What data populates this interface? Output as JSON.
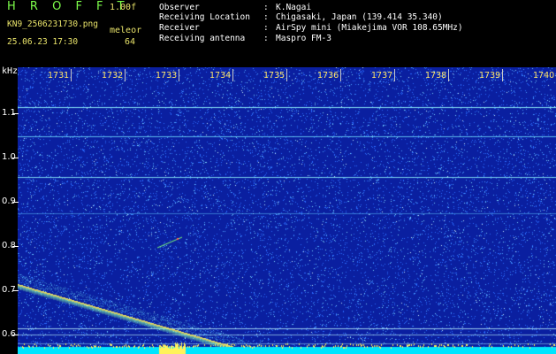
{
  "header": {
    "app_title": "H R O F F T",
    "version": "1.00f",
    "file": "KN9_2506231730.png",
    "mode": "meleor",
    "datetime": "25.06.23 17:30",
    "number": "64",
    "info": [
      {
        "label": "Observer",
        "value": "K.Nagai"
      },
      {
        "label": "Receiving Location",
        "value": "Chigasaki, Japan (139.414 35.340)"
      },
      {
        "label": "Receiver",
        "value": "AirSpy mini (Miakejima VOR 108.65MHz)"
      },
      {
        "label": "Receiving antenna",
        "value": "Maspro FM-3"
      }
    ]
  },
  "chart_data": {
    "type": "heatmap",
    "ylabel": "kHz",
    "y_ticks": [
      "1.1",
      "1.0",
      "0.9",
      "0.8",
      "0.7",
      "0.6"
    ],
    "x_ticks": [
      "1731",
      "1732",
      "1733",
      "1734",
      "1735",
      "1736",
      "1737",
      "1738",
      "1739",
      "1740"
    ],
    "colors": {
      "background": "#0a1fa0",
      "noise": "#3a8fff",
      "signal": "#fff35a",
      "base": "#00e5ff"
    }
  }
}
